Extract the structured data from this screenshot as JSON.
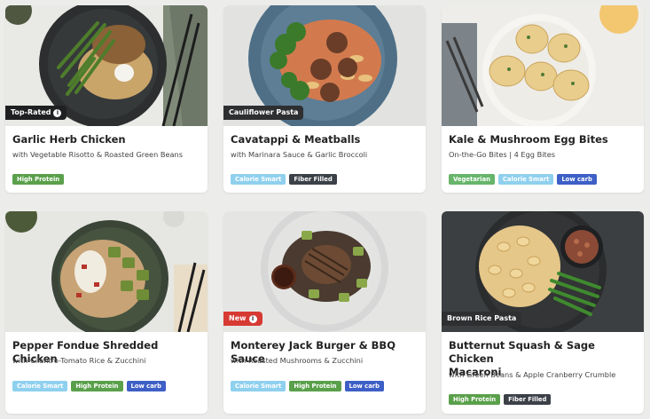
{
  "colors": {
    "high_protein": "#5aa04b",
    "calorie_smart": "#8fd0ee",
    "fiber_filled": "#3c4148",
    "low_carb": "#3d5fc6",
    "vegetarian": "#66b56a",
    "new_tag": "#d63a33",
    "dark_tag": "#2d2f31"
  },
  "meals": [
    {
      "title": "Garlic Herb Chicken",
      "subtitle": "with Vegetable Risotto & Roasted Green Beans",
      "tag": "Top-Rated",
      "badges": [
        "High Protein"
      ]
    },
    {
      "title": "Cavatappi & Meatballs",
      "subtitle": "with Marinara Sauce & Garlic Broccoli",
      "tag": "Cauliflower Pasta",
      "badges": [
        "Calorie Smart",
        "Fiber Filled"
      ]
    },
    {
      "title": "Kale & Mushroom Egg Bites",
      "subtitle": "On-the-Go Bites | 4 Egg Bites",
      "tag": "",
      "badges": [
        "Vegetarian",
        "Calorie Smart",
        "Low carb"
      ]
    },
    {
      "title": "Pepper Fondue Shredded Chicken",
      "subtitle": "with Cilantro-Tomato Rice & Zucchini",
      "tag": "",
      "badges": [
        "Calorie Smart",
        "High Protein",
        "Low carb"
      ]
    },
    {
      "title": "Monterey Jack Burger & BBQ Sauce",
      "subtitle": "with Roasted Mushrooms & Zucchini",
      "tag": "New",
      "badges": [
        "Calorie Smart",
        "High Protein",
        "Low carb"
      ]
    },
    {
      "title_line1": "Butternut Squash & Sage Chicken",
      "title_line2": "Macaroni",
      "subtitle": "with Green Beans & Apple Cranberry Crumble",
      "tag": "Brown Rice Pasta",
      "badges": [
        "High Protein",
        "Fiber Filled"
      ]
    }
  ]
}
